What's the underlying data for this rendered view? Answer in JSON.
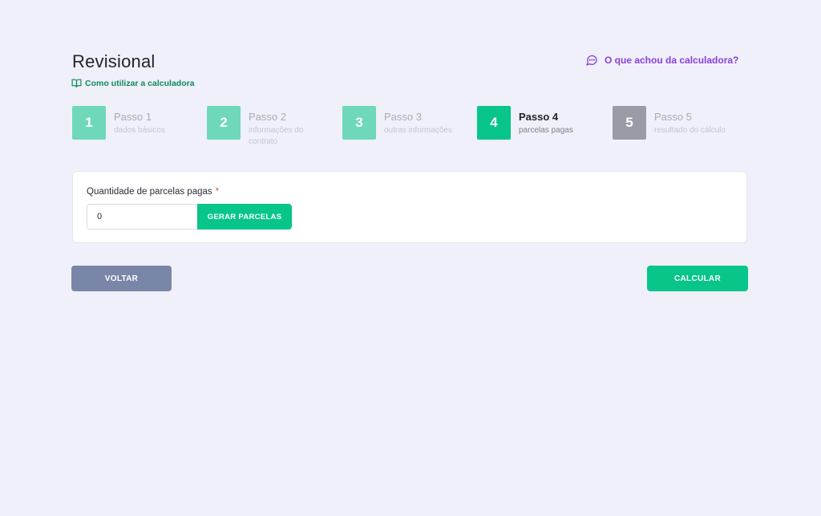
{
  "header": {
    "title": "Revisional",
    "help_link": "Como utilizar a calculadora",
    "feedback_link": "O que achou da calculadora?"
  },
  "colors": {
    "accent": "#08c58a",
    "accent_light": "#6fd8b9",
    "pending": "#9b9ba7",
    "feedback": "#8a3ee0",
    "help": "#0f8a5a",
    "back_button": "#7a86a8"
  },
  "steps": [
    {
      "number": "1",
      "title": "Passo 1",
      "subtitle": "dados básicos",
      "state": "done"
    },
    {
      "number": "2",
      "title": "Passo 2",
      "subtitle": "informações do contrato",
      "state": "done"
    },
    {
      "number": "3",
      "title": "Passo 3",
      "subtitle": "outras informações",
      "state": "done"
    },
    {
      "number": "4",
      "title": "Passo 4",
      "subtitle": "parcelas pagas",
      "state": "active"
    },
    {
      "number": "5",
      "title": "Passo 5",
      "subtitle": "resultado do cálculo",
      "state": "pending"
    }
  ],
  "form": {
    "quantity_label": "Quantidade de parcelas pagas",
    "required_mark": "*",
    "quantity_value": "0",
    "generate_button": "GERAR PARCELAS"
  },
  "actions": {
    "back": "VOLTAR",
    "calculate": "CALCULAR"
  }
}
